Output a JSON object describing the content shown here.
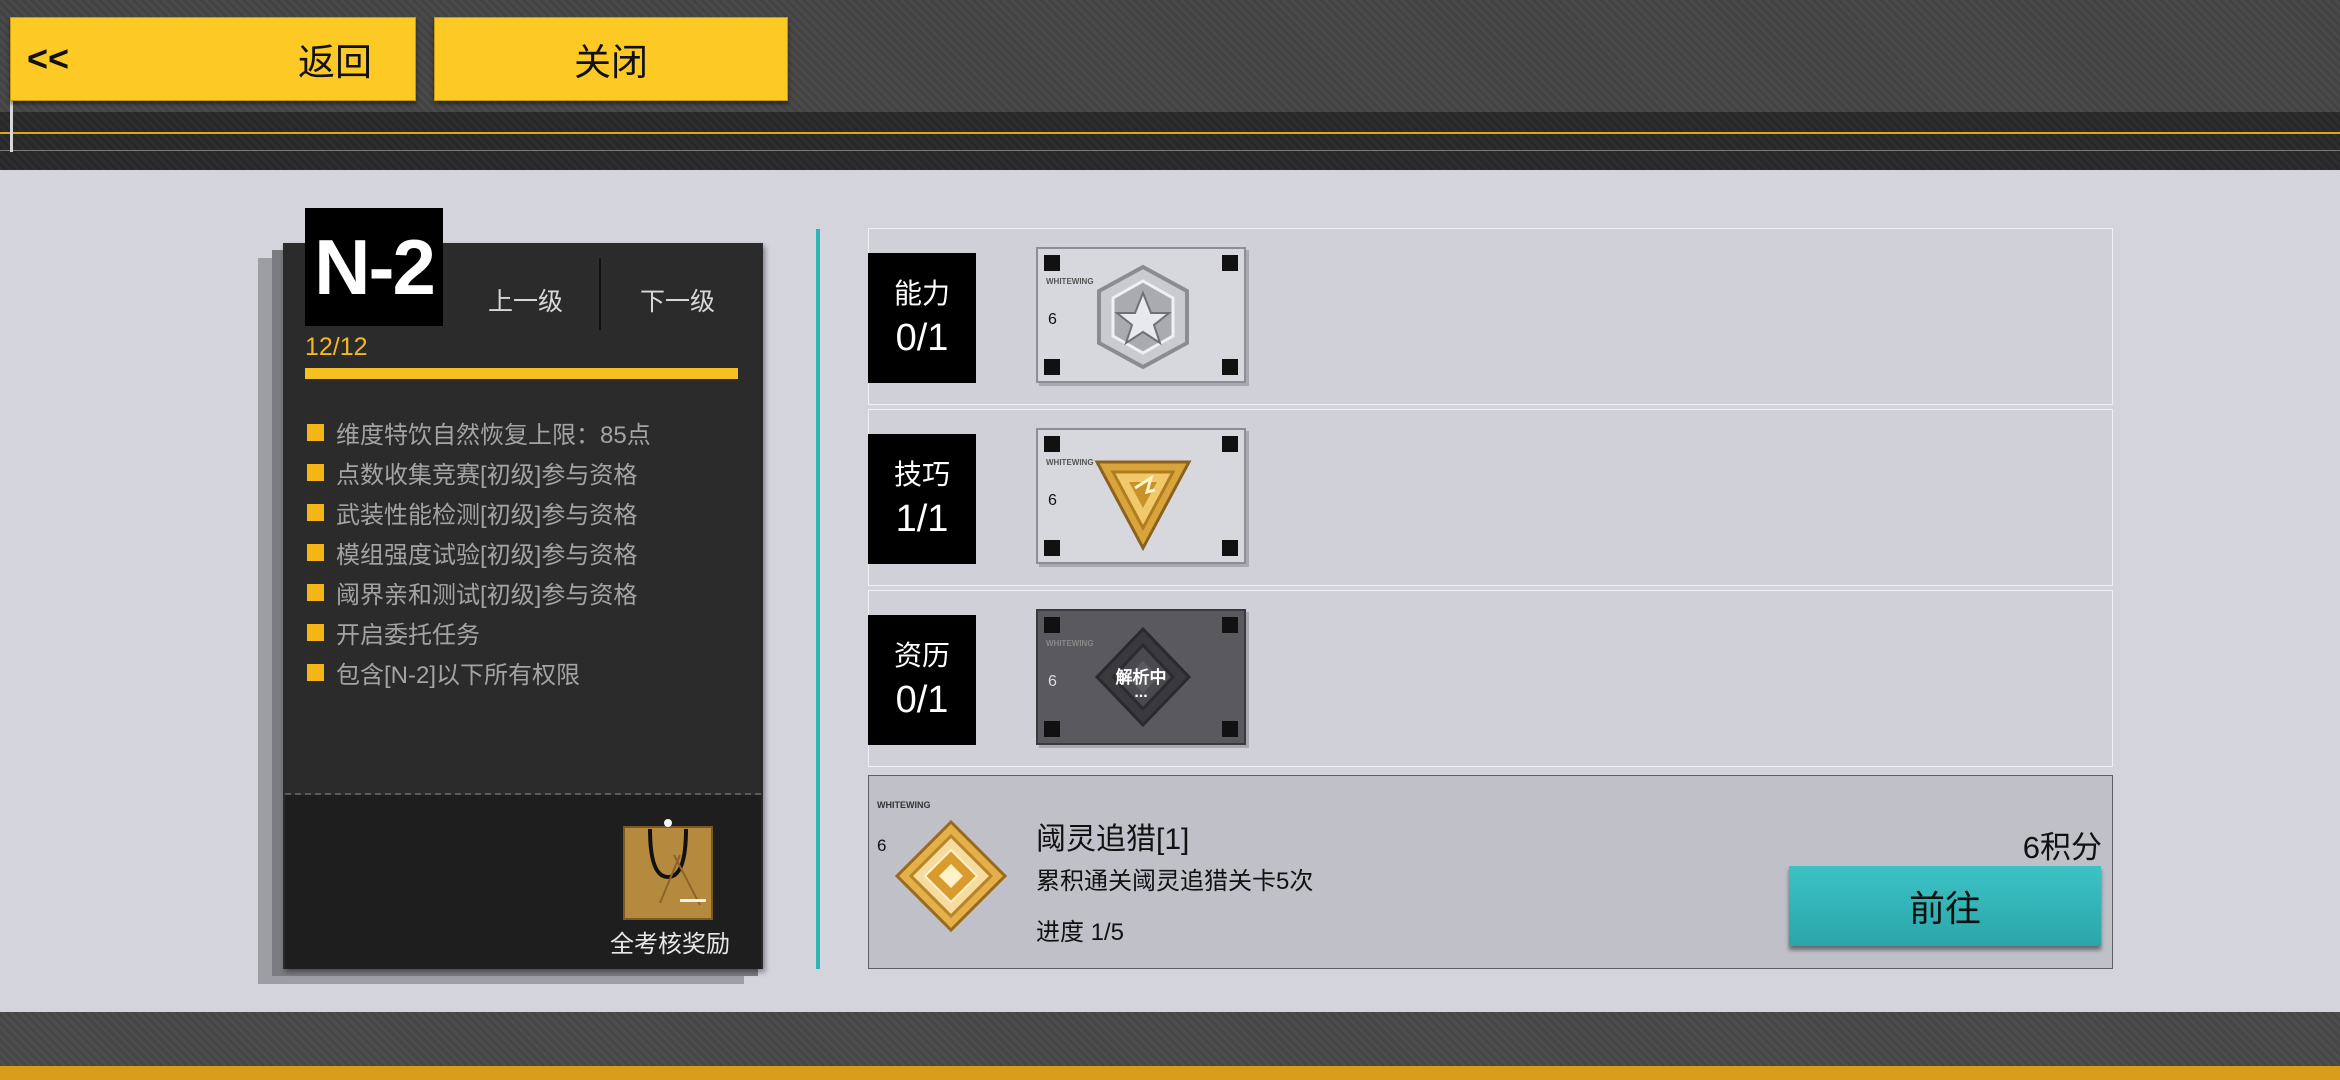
{
  "header": {
    "back_arrows": "<<",
    "back_label": "返回",
    "close_label": "关闭"
  },
  "rank": {
    "code": "N-2",
    "prev_label": "上一级",
    "next_label": "下一级",
    "progress_text": "12/12",
    "progress_fraction": 1.0,
    "perks": [
      "维度特饮自然恢复上限：85点",
      "点数收集竞赛[初级]参与资格",
      "武装性能检测[初级]参与资格",
      "模组强度试验[初级]参与资格",
      "阈界亲和测试[初级]参与资格",
      "开启委托任务",
      "包含[N-2]以下所有权限"
    ],
    "reward_label": "全考核奖励"
  },
  "categories": [
    {
      "name": "能力",
      "count": "0/1",
      "medal_brand": "WHITEWING",
      "medal_level": "6",
      "medal_icon": "silver-hexagon-star-icon"
    },
    {
      "name": "技巧",
      "count": "1/1",
      "medal_brand": "WHITEWING",
      "medal_level": "6",
      "medal_icon": "gold-triangle-icon"
    },
    {
      "name": "资历",
      "count": "0/1",
      "medal_brand": "WHITEWING",
      "medal_level": "6",
      "medal_icon": "locked-diamond-icon",
      "status": "解析中",
      "status_dots": "..."
    }
  ],
  "task": {
    "brand": "WHITEWING",
    "level": "6",
    "title": "阈灵追猎[1]",
    "description": "累积通关阈灵追猎关卡5次",
    "progress": "进度 1/5",
    "points": "6积分",
    "go_label": "前往"
  },
  "colors": {
    "accent_yellow": "#fdc924",
    "accent_teal": "#2fb3b5",
    "progress_gold": "#f6c022"
  }
}
